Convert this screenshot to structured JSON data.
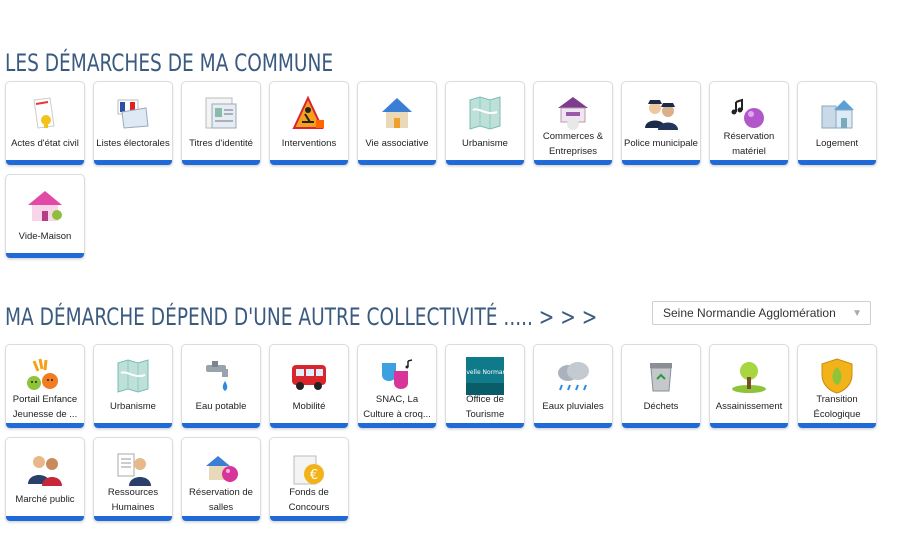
{
  "sections": {
    "commune_title": "LES DÉMARCHES DE MA COMMUNE",
    "other_title": "MA DÉMARCHE DÉPEND D'UNE AUTRE COLLECTIVITÉ ..... > > >"
  },
  "dropdown": {
    "selected": "Seine Normandie Agglomération",
    "arrow": "▼"
  },
  "commune_tiles": [
    {
      "label": "Actes d'état civil",
      "icon": "civil-status-icon"
    },
    {
      "label": "Listes électorales",
      "icon": "ballot-icon"
    },
    {
      "label": "Titres d'identité",
      "icon": "id-card-icon"
    },
    {
      "label": "Interventions",
      "icon": "roadwork-icon"
    },
    {
      "label": "Vie associative",
      "icon": "house-icon"
    },
    {
      "label": "Urbanisme",
      "icon": "map-icon"
    },
    {
      "label": "Commerces & Entreprises",
      "icon": "shop-icon"
    },
    {
      "label": "Police municipale",
      "icon": "police-icon"
    },
    {
      "label": "Réservation matériel",
      "icon": "music-icon"
    },
    {
      "label": "Logement",
      "icon": "housing-icon"
    },
    {
      "label": "Vide-Maison",
      "icon": "pink-house-icon"
    }
  ],
  "other_tiles": [
    {
      "label": "Portail Enfance Jeunesse de ...",
      "icon": "children-icon"
    },
    {
      "label": "Urbanisme",
      "icon": "map-icon"
    },
    {
      "label": "Eau potable",
      "icon": "tap-icon"
    },
    {
      "label": "Mobilité",
      "icon": "bus-icon"
    },
    {
      "label": "SNAC, La Culture à croq...",
      "icon": "theatre-icon"
    },
    {
      "label": "Office de Tourisme",
      "icon": "tourism-icon",
      "icon_text": "Nouvelle Normandie"
    },
    {
      "label": "Eaux pluviales",
      "icon": "rain-cloud-icon"
    },
    {
      "label": "Déchets",
      "icon": "trash-icon"
    },
    {
      "label": "Assainissement",
      "icon": "tree-icon"
    },
    {
      "label": "Transition Écologique",
      "icon": "eco-shield-icon"
    },
    {
      "label": "Marché public",
      "icon": "people-icon"
    },
    {
      "label": "Ressources Humaines",
      "icon": "hr-icon"
    },
    {
      "label": "Réservation de salles",
      "icon": "room-booking-icon"
    },
    {
      "label": "Fonds de Concours",
      "icon": "euro-icon"
    }
  ],
  "colors": {
    "title": "#3a5a80",
    "tile_accent": "#1f6ad6",
    "tile_border": "#dcdcdc"
  }
}
